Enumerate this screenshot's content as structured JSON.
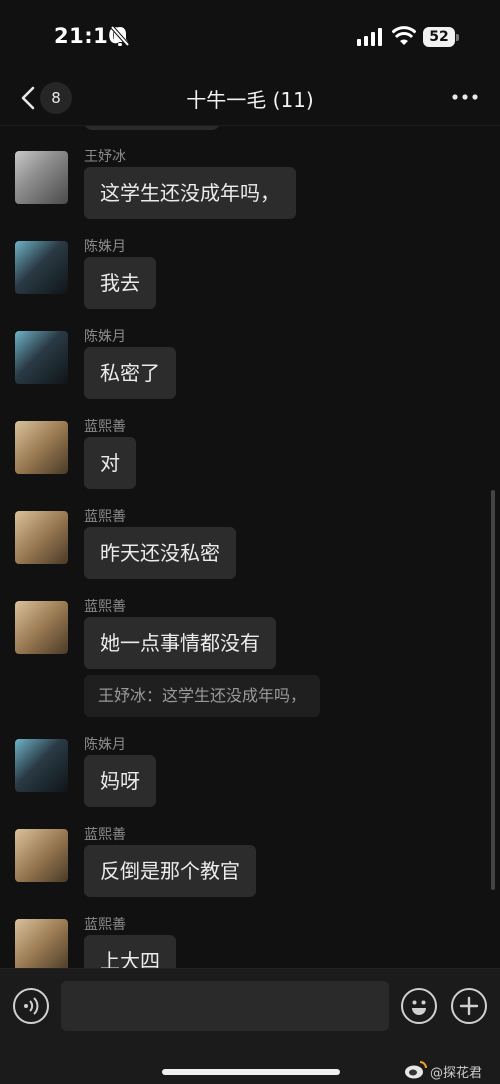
{
  "status_bar": {
    "time": "21:10",
    "battery": "52"
  },
  "header": {
    "back_badge": "8",
    "title": "十牛一毛 (11)"
  },
  "messages": [
    {
      "sender": "王妤冰",
      "text": "这学生还没成年吗，"
    },
    {
      "sender": "陈姝月",
      "text": "我去"
    },
    {
      "sender": "陈姝月",
      "text": "私密了"
    },
    {
      "sender": "蓝熙善",
      "text": "对"
    },
    {
      "sender": "蓝熙善",
      "text": "昨天还没私密"
    },
    {
      "sender": "蓝熙善",
      "text": "她一点事情都没有",
      "quote": "王妤冰：这学生还没成年吗，"
    },
    {
      "sender": "陈姝月",
      "text": "妈呀"
    },
    {
      "sender": "蓝熙善",
      "text": "反倒是那个教官"
    },
    {
      "sender": "蓝熙善",
      "text": "上大四"
    }
  ],
  "input": {
    "value": ""
  },
  "watermark": {
    "text": "@探花君"
  }
}
